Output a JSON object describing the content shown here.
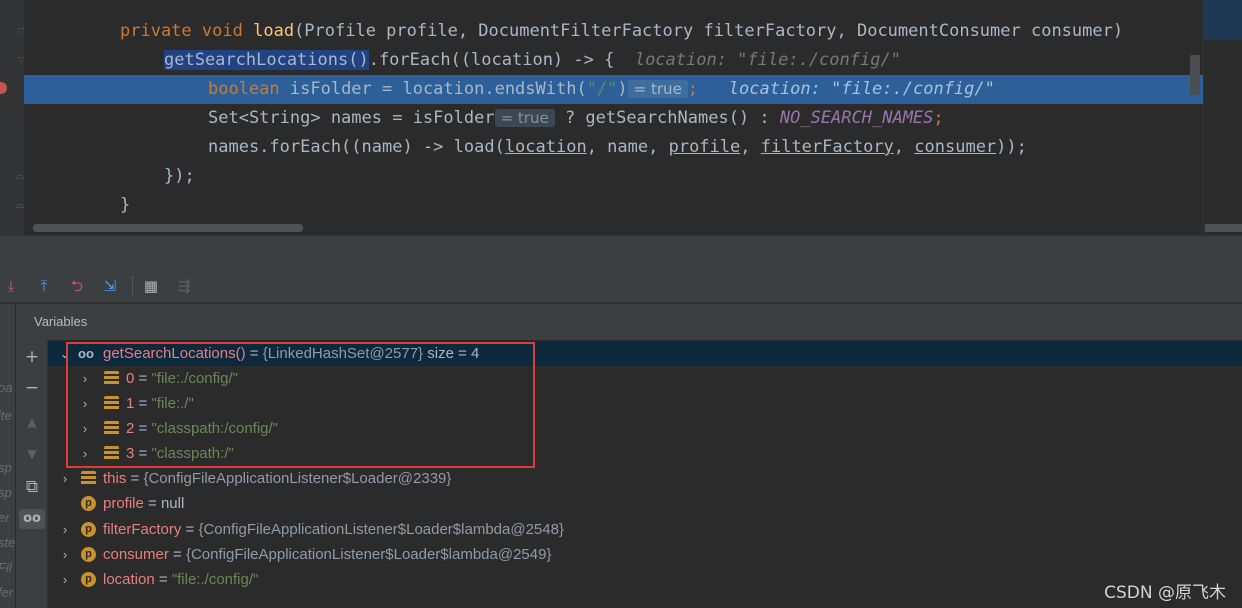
{
  "editor": {
    "lines": {
      "l1": {
        "kw1": "private",
        "kw2": "void",
        "fn": "load",
        "p1": "(Profile profile, DocumentFilterFactory filterFactory, DocumentConsumer consumer)"
      },
      "l2": {
        "call": "getSearchLocations()",
        "rest": ".forEach((location) -> {",
        "hint": "location: \"file:./config/\""
      },
      "l3": {
        "kw": "boolean",
        "mid": " isFolder = location.endsWith(",
        "str": "\"/\"",
        "close": ")",
        "inline": "= true",
        "semi": ";",
        "hint": "location: \"file:./config/\""
      },
      "l4": {
        "pre": "Set<String> names = isFolder",
        "inline": "= true",
        "mid": " ? getSearchNames() : ",
        "cst": "NO_SEARCH_NAMES",
        "semi": ";"
      },
      "l5": {
        "pre": "names.forEach((name) -> load(",
        "a1": "location",
        "s1": ", name, ",
        "a2": "profile",
        "s2": ", ",
        "a3": "filterFactory",
        "s3": ", ",
        "a4": "consumer",
        "end": "));"
      },
      "l6": {
        "text": "});"
      },
      "l7": {
        "text": "}"
      }
    }
  },
  "debug": {
    "section_title": "Variables",
    "left_fragments": [
      "oa",
      "ite",
      "sp",
      "sp",
      "er",
      "ste",
      "Fil",
      "fer"
    ],
    "tree": [
      {
        "name": "getSearchLocations()",
        "eq": " = ",
        "value": "{LinkedHashSet@2577}",
        "extra": "  size = 4"
      },
      {
        "name": "0",
        "eq": " = ",
        "value": "\"file:./config/\""
      },
      {
        "name": "1",
        "eq": " = ",
        "value": "\"file:./\""
      },
      {
        "name": "2",
        "eq": " = ",
        "value": "\"classpath:/config/\""
      },
      {
        "name": "3",
        "eq": " = ",
        "value": "\"classpath:/\""
      },
      {
        "name": "this",
        "eq": " = ",
        "value": "{ConfigFileApplicationListener$Loader@2339}"
      },
      {
        "name": "profile",
        "eq": " = ",
        "value": "null"
      },
      {
        "name": "filterFactory",
        "eq": " = ",
        "value": "{ConfigFileApplicationListener$Loader$lambda@2548}"
      },
      {
        "name": "consumer",
        "eq": " = ",
        "value": "{ConfigFileApplicationListener$Loader$lambda@2549}"
      },
      {
        "name": "location",
        "eq": " = ",
        "value": "\"file:./config/\""
      }
    ]
  },
  "watermark": "CSDN @原飞木",
  "colors": {
    "accent_highlight": "#2d6099",
    "annotation_box": "#e0393e"
  }
}
